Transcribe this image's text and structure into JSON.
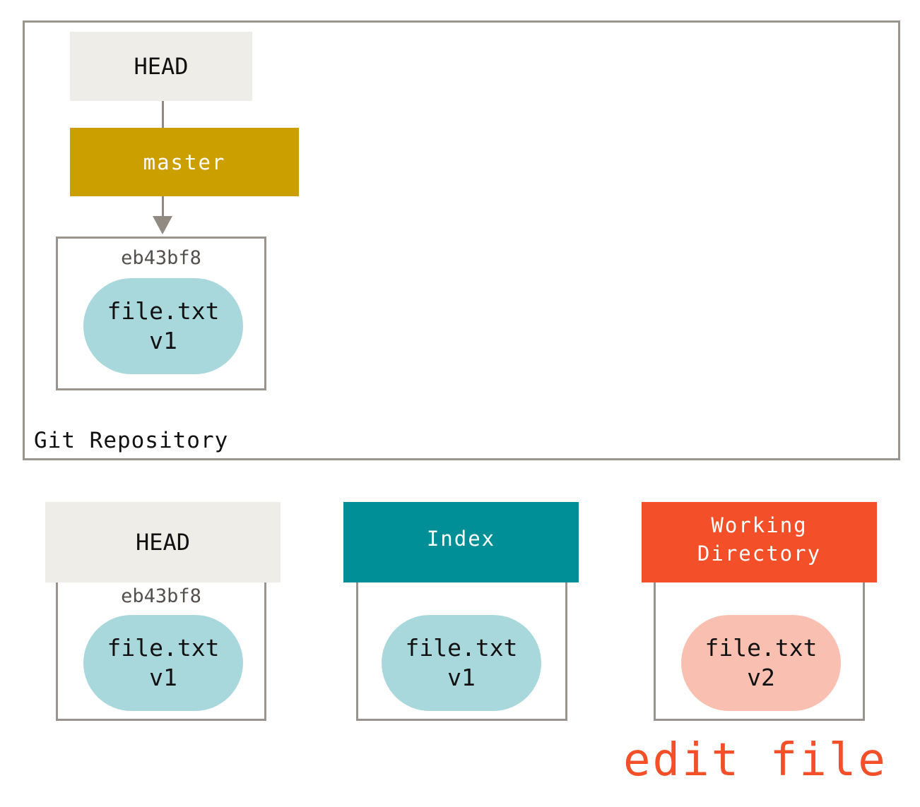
{
  "repository": {
    "label": "Git Repository",
    "head_label": "HEAD",
    "branch_label": "master",
    "commit": {
      "hash": "eb43bf8",
      "file": {
        "name": "file.txt",
        "version": "v1"
      }
    }
  },
  "trees": [
    {
      "label": "HEAD",
      "hash": "eb43bf8",
      "file": {
        "name": "file.txt",
        "version": "v1"
      }
    },
    {
      "label": "Index",
      "hash": "",
      "file": {
        "name": "file.txt",
        "version": "v1"
      }
    },
    {
      "label_line1": "Working",
      "label_line2": "Directory",
      "file": {
        "name": "file.txt",
        "version": "v2"
      }
    }
  ],
  "action": "edit file",
  "colors": {
    "head": "#eeede7",
    "branch": "#cc9f00",
    "index": "#008f97",
    "working_directory": "#f34f29",
    "blob_committed": "#a9d8dc",
    "blob_modified": "#f9c0b2",
    "border": "#99948d"
  }
}
